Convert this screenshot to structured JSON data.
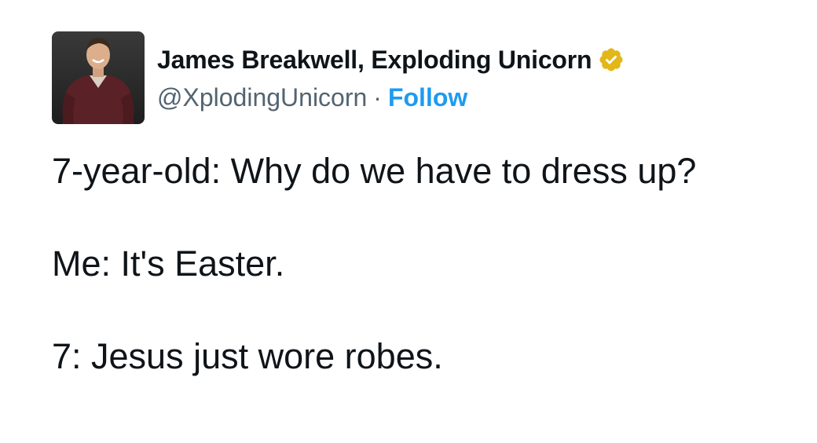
{
  "tweet": {
    "author": {
      "display_name": "James Breakwell, Exploding Unicorn",
      "handle": "@XplodingUnicorn",
      "separator": "·",
      "follow_label": "Follow",
      "avatar_icon": "user-avatar-photo",
      "verified_icon": "verified-badge-icon",
      "verified_color": "#e2b719"
    },
    "lines": [
      "7-year-old: Why do we have to dress up?",
      "Me: It's Easter.",
      "7: Jesus just wore robes."
    ],
    "colors": {
      "text": "#0f1419",
      "secondary": "#536471",
      "link": "#1d9bf0"
    }
  }
}
